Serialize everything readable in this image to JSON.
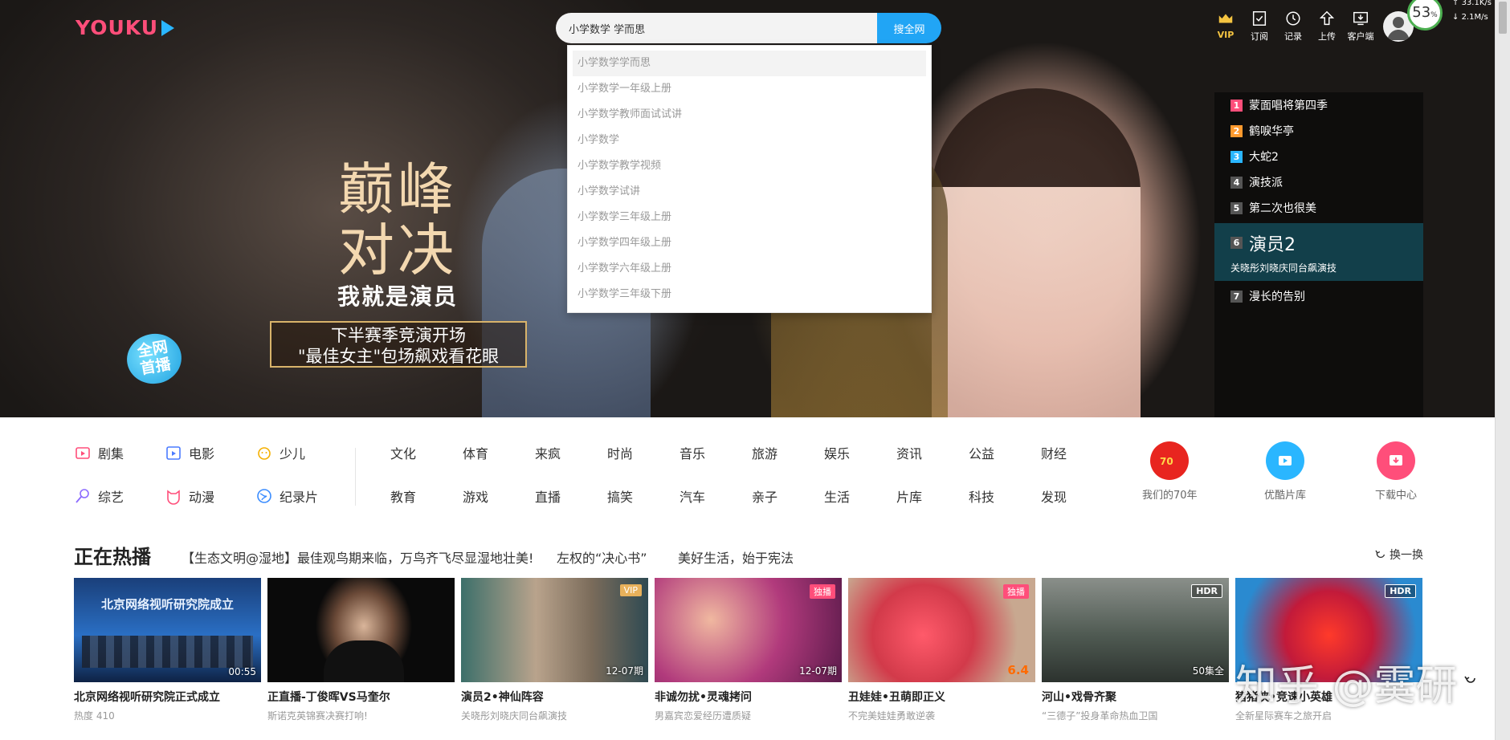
{
  "logo": {
    "text_you": "YOU",
    "text_ku": "KU"
  },
  "search": {
    "value": "小学数学 学而思",
    "button": "搜全网"
  },
  "suggestions": [
    "小学数学学而思",
    "小学数学一年级上册",
    "小学数学教师面试试讲",
    "小学数学",
    "小学数学教学视频",
    "小学数学试讲",
    "小学数学三年级上册",
    "小学数学四年级上册",
    "小学数学六年级上册",
    "小学数学三年级下册"
  ],
  "top_icons": [
    {
      "label": "VIP",
      "icon": "crown-icon"
    },
    {
      "label": "订阅",
      "icon": "subscribe-icon"
    },
    {
      "label": "记录",
      "icon": "history-icon"
    },
    {
      "label": "上传",
      "icon": "upload-icon"
    },
    {
      "label": "客户端",
      "icon": "client-icon"
    }
  ],
  "net_widget": {
    "percent": "53",
    "unit": "%",
    "up": "33.1K/s",
    "down": "2.1M/s"
  },
  "ranking": {
    "top": [
      {
        "num": "1",
        "title": "蒙面唱将第四季"
      },
      {
        "num": "2",
        "title": "鹤唳华亭"
      },
      {
        "num": "3",
        "title": "大蛇2"
      },
      {
        "num": "4",
        "title": "演技派"
      },
      {
        "num": "5",
        "title": "第二次也很美"
      }
    ],
    "active": {
      "num": "6",
      "title": "演员2",
      "sub": "关晓彤刘晓庆同台飙演技"
    },
    "after": [
      {
        "num": "7",
        "title": "漫长的告别"
      }
    ]
  },
  "banner": {
    "title_line1": "巅峰",
    "title_line2": "对决",
    "slogan": "我就是演员",
    "ribbon_line1": "下半赛季竞演开场",
    "ribbon_line2": "\"最佳女主\"包场飙戏看花眼",
    "live_line1": "全网",
    "live_line2": "首播"
  },
  "categories": [
    {
      "label": "剧集",
      "icon": "tv-series-icon"
    },
    {
      "label": "电影",
      "icon": "movie-icon"
    },
    {
      "label": "少儿",
      "icon": "kids-icon"
    },
    {
      "label": "综艺",
      "icon": "variety-icon"
    },
    {
      "label": "动漫",
      "icon": "anime-icon"
    },
    {
      "label": "纪录片",
      "icon": "documentary-icon"
    }
  ],
  "tags_row1": [
    "文化",
    "体育",
    "来疯",
    "时尚",
    "音乐",
    "旅游",
    "娱乐",
    "资讯",
    "公益",
    "财经"
  ],
  "tags_row2": [
    "教育",
    "游戏",
    "直播",
    "搞笑",
    "汽车",
    "亲子",
    "生活",
    "片库",
    "科技",
    "发现"
  ],
  "quick_links": [
    {
      "label": "我们的70年",
      "icon": "seventy-years-icon",
      "color": "#e8251f"
    },
    {
      "label": "优酷片库",
      "icon": "library-icon",
      "color": "#2ab6ff"
    },
    {
      "label": "下载中心",
      "icon": "download-icon",
      "color": "#ff4e7a"
    }
  ],
  "hot": {
    "title": "正在热播",
    "links": [
      "【生态文明@湿地】最佳观鸟期来临，万鸟齐飞尽显湿地壮美!",
      "左权的“决心书”",
      "美好生活，始于宪法"
    ],
    "refresh": "换一换"
  },
  "cards": [
    {
      "title": "北京网络视听研究院正式成立",
      "sub": "热度 410",
      "overlay": "00:55",
      "badge": "",
      "thumb_text": "北京网络视听研究院成立"
    },
    {
      "title": "正直播-丁俊晖VS马奎尔",
      "sub": "斯诺克英锦赛决赛打响!",
      "overlay": "",
      "badge": "",
      "thumb_text": ""
    },
    {
      "title": "演员2•神仙阵容",
      "sub": "关晓彤刘晓庆同台飙演技",
      "overlay": "12-07期",
      "badge": "VIP",
      "thumb_text": ""
    },
    {
      "title": "非诚勿扰•灵魂拷问",
      "sub": "男嘉宾恋爱经历遭质疑",
      "overlay": "12-07期",
      "badge": "独播",
      "thumb_text": ""
    },
    {
      "title": "丑娃娃•丑萌即正义",
      "sub": "不完美娃娃勇敢逆袭",
      "overlay": "",
      "score": "6.4",
      "badge": "独播",
      "thumb_text": ""
    },
    {
      "title": "河山•戏骨齐聚",
      "sub": "“三德子”投身革命热血卫国",
      "overlay": "50集全",
      "badge": "HDR",
      "thumb_text": ""
    },
    {
      "title": "猪猪侠•竞速小英雄",
      "sub": "全新星际赛车之旅开启",
      "overlay": "",
      "badge": "HDR",
      "thumb_text": ""
    }
  ],
  "watermark": "知乎 @霙研"
}
